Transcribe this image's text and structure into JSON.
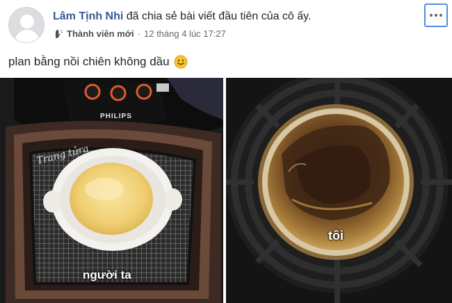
{
  "post": {
    "author_name": "Lâm Tịnh Nhi",
    "action_text": "đã chia sẻ bài viết đầu tiên của cô ấy.",
    "badge_label": "Thành viên mới",
    "separator": "·",
    "timestamp": "12 tháng 4 lúc 17:27",
    "text": "plan bằng nồi chiên không dầu",
    "emoji_icon": "smiley-icon",
    "more_icon": "more-options-icon"
  },
  "photos": {
    "left": {
      "brand_text": "PHILIPS",
      "watermark_text": "Trang tửra",
      "caption": "người ta"
    },
    "right": {
      "caption": "tôi"
    }
  },
  "colors": {
    "author": "#385898",
    "meta": "#606770",
    "focus_outline": "#4a90e2"
  }
}
